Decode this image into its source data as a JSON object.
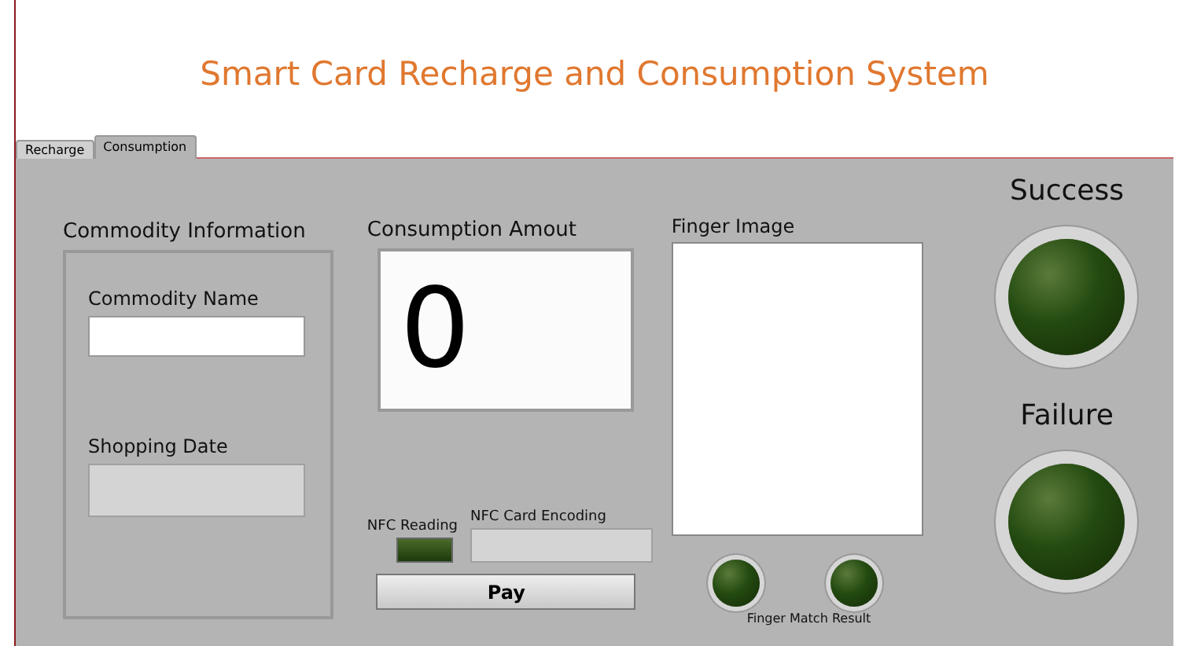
{
  "title": "Smart Card Recharge and Consumption System",
  "tabs": [
    {
      "label": "Recharge",
      "selected": false
    },
    {
      "label": "Consumption",
      "selected": true
    }
  ],
  "commodity": {
    "title": "Commodity Information",
    "name_label": "Commodity Name",
    "date_label": "Shopping Date"
  },
  "amount": {
    "label": "Consumption Amout",
    "value": "0"
  },
  "nfc": {
    "reading_label": "NFC Reading",
    "reading_on": false,
    "encoding_label": "NFC Card Encoding"
  },
  "pay_button": "Pay",
  "finger": {
    "label": "Finger Image",
    "match_label": "Finger Match Result",
    "leds": [
      {
        "on": false
      },
      {
        "on": false
      }
    ]
  },
  "success": {
    "label": "Success",
    "on": false
  },
  "failure": {
    "label": "Failure",
    "on": false
  }
}
